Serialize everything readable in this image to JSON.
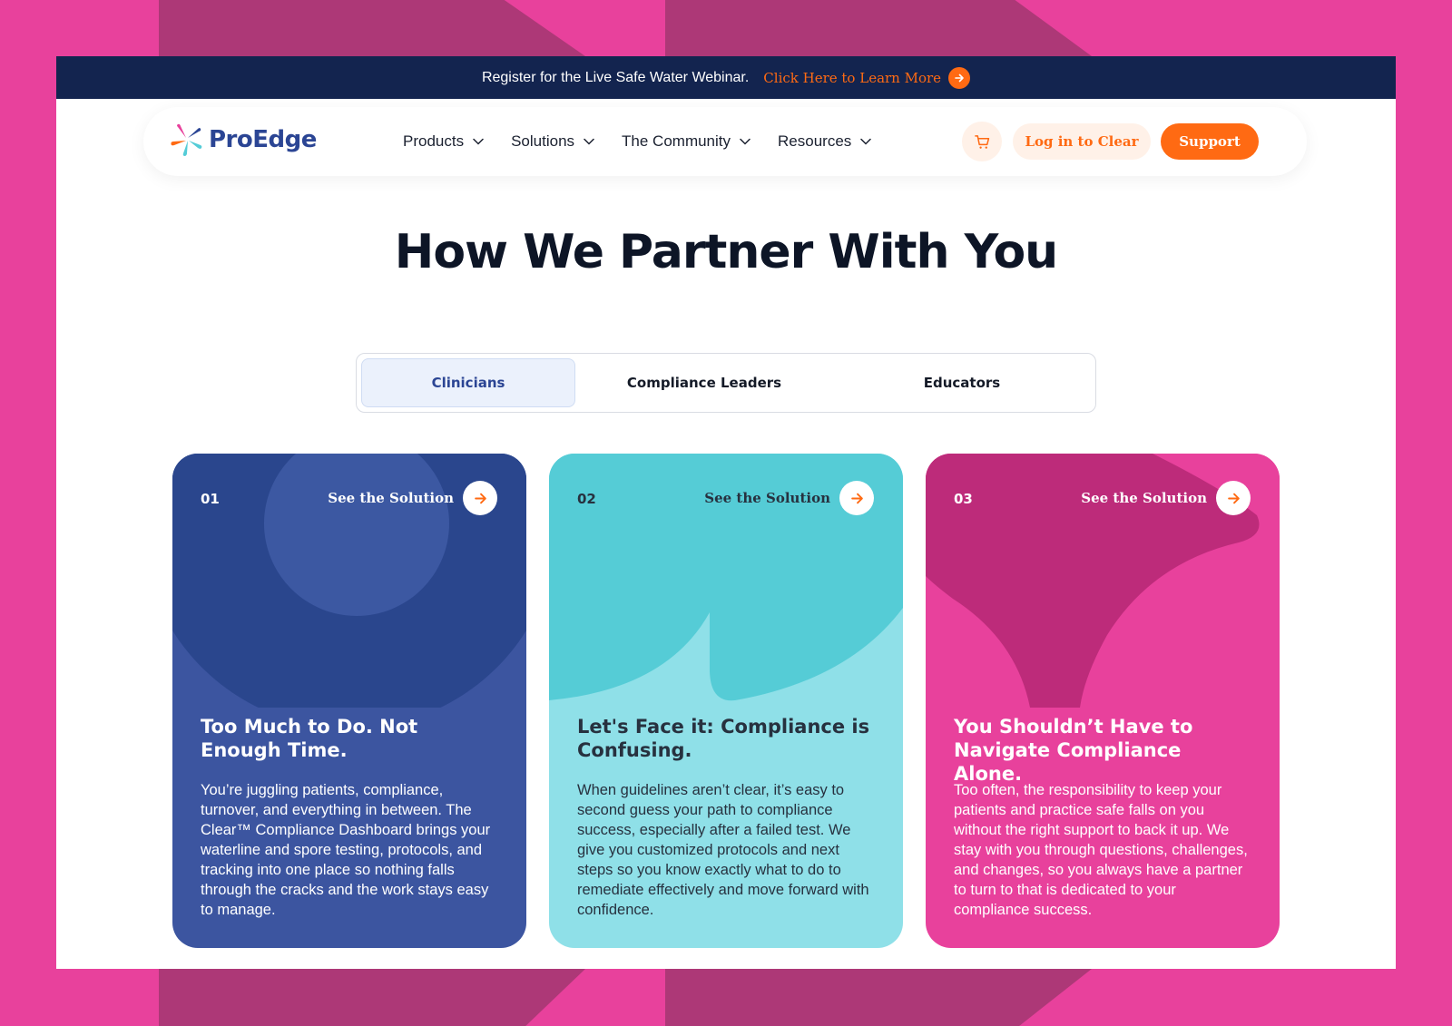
{
  "banner": {
    "text": "Register for the Live Safe Water Webinar.",
    "link_label": "Click Here to Learn More",
    "link_icon": "arrow-right-icon"
  },
  "nav": {
    "logo_text": "ProEdge",
    "menu": [
      {
        "label": "Products"
      },
      {
        "label": "Solutions"
      },
      {
        "label": "The Community"
      },
      {
        "label": "Resources"
      }
    ],
    "cart_icon": "cart-icon",
    "login_label": "Log in to Clear",
    "support_label": "Support"
  },
  "section": {
    "heading": "How We Partner With You"
  },
  "tabs": [
    {
      "label": "Clinicians",
      "active": true
    },
    {
      "label": "Compliance Leaders",
      "active": false
    },
    {
      "label": "Educators",
      "active": false
    }
  ],
  "cards": [
    {
      "number": "01",
      "cta": "See the Solution",
      "title": "Too Much to Do. Not Enough Time.",
      "body": "You’re juggling patients, compliance, turnover, and everything in between. The Clear™ Compliance Dashboard brings your waterline and spore testing, protocols, and tracking into one place so nothing falls through the cracks and the work stays easy to manage."
    },
    {
      "number": "02",
      "cta": "See the Solution",
      "title": "Let's Face it: Compliance is Confusing.",
      "body": "When guidelines aren’t clear, it’s easy to second guess your path to compliance success, especially after a failed test. We give you customized protocols and next steps so you know exactly what to do to remediate effectively and move forward with confidence."
    },
    {
      "number": "03",
      "cta": "See the Solution",
      "title": "You Shouldn’t Have to Navigate Compliance Alone.",
      "body": "Too often, the responsibility to keep your patients and practice safe falls on you without the right support to back it up. We stay with you through questions, challenges, and changes, so you always have a partner to turn to that is dedicated to your compliance success."
    }
  ],
  "colors": {
    "navy": "#13244f",
    "orange": "#ff6a13",
    "card_blue": "#3c55a0",
    "card_teal": "#8fe0e8",
    "card_pink": "#e8419c",
    "background_pink": "#e8419c"
  }
}
